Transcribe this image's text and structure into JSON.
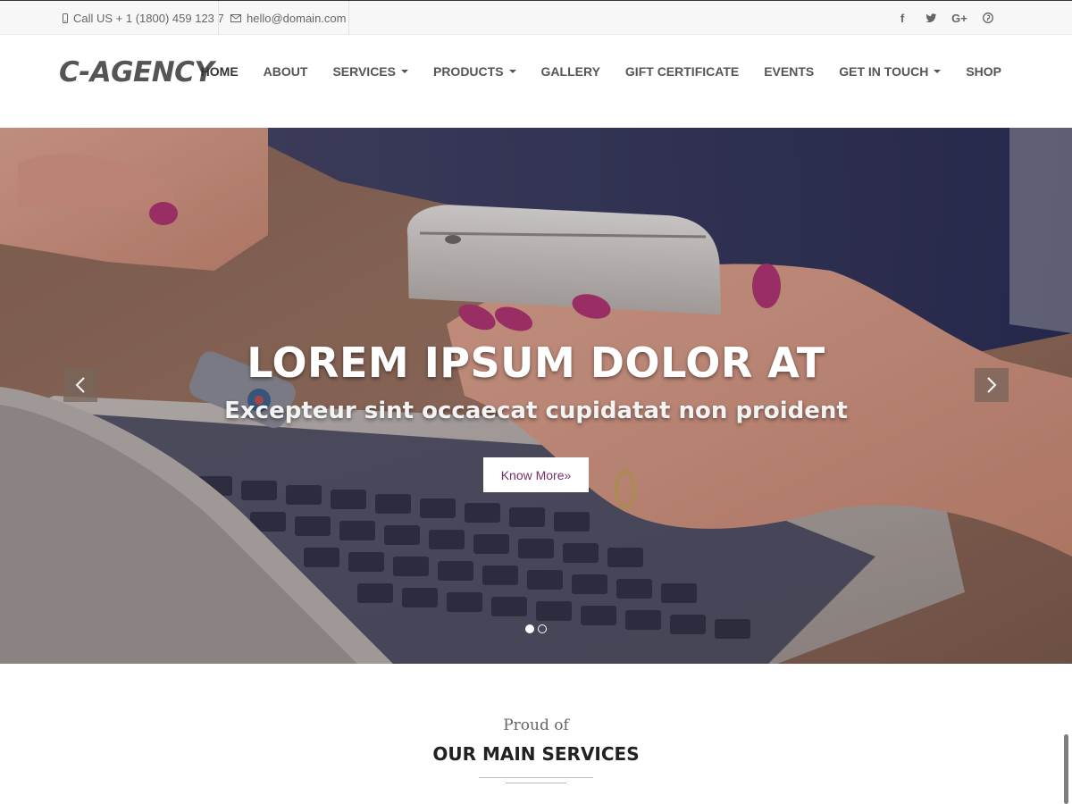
{
  "topbar": {
    "phone": "Call US + 1 (1800) 459 123 7",
    "email": "hello@domain.com",
    "social": [
      {
        "icon": "facebook-icon",
        "glyph": "f"
      },
      {
        "icon": "twitter-icon",
        "glyph": "t"
      },
      {
        "icon": "google-plus-icon",
        "glyph": "G+"
      },
      {
        "icon": "pinterest-icon",
        "glyph": "p"
      }
    ]
  },
  "header": {
    "logo": "C-AGENCY",
    "nav": [
      {
        "label": "HOME",
        "dropdown": false,
        "active": true
      },
      {
        "label": "ABOUT",
        "dropdown": false
      },
      {
        "label": "SERVICES",
        "dropdown": true
      },
      {
        "label": "PRODUCTS",
        "dropdown": true
      },
      {
        "label": "GALLERY",
        "dropdown": false
      },
      {
        "label": "GIFT CERTIFICATE",
        "dropdown": false
      },
      {
        "label": "EVENTS",
        "dropdown": false
      },
      {
        "label": "GET IN TOUCH",
        "dropdown": true
      },
      {
        "label": "SHOP",
        "dropdown": false
      }
    ]
  },
  "hero": {
    "title": "LOREM IPSUM DOLOR AT",
    "subtitle": "Excepteur sint occaecat cupidatat non proident",
    "button": "Know More»",
    "slides": 2,
    "active_slide": 1
  },
  "services": {
    "kicker": "Proud of",
    "title": "OUR MAIN SERVICES"
  },
  "colors": {
    "button_text": "#7a2e6b",
    "topbar_bg": "#f7f7f7",
    "nail_polish": "#b0306f"
  }
}
